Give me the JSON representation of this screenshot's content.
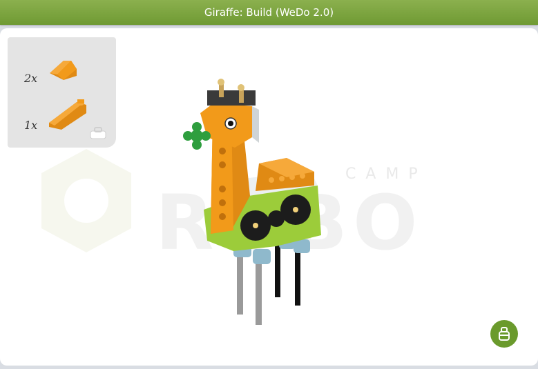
{
  "window": {
    "title": "Giraffe: Build (WeDo 2.0)"
  },
  "watermark": {
    "top_text": "CAMP",
    "main_text": "ROBO"
  },
  "parts": [
    {
      "quantity": "2x",
      "icon": "orange-slope-brick-small-icon"
    },
    {
      "quantity": "1x",
      "icon": "orange-slope-brick-long-icon"
    }
  ],
  "bag_button": {
    "icon": "bag-icon"
  },
  "colors": {
    "accent": "#6f9a33",
    "part_orange": "#f29a1a",
    "lime": "#9ccc3a"
  }
}
